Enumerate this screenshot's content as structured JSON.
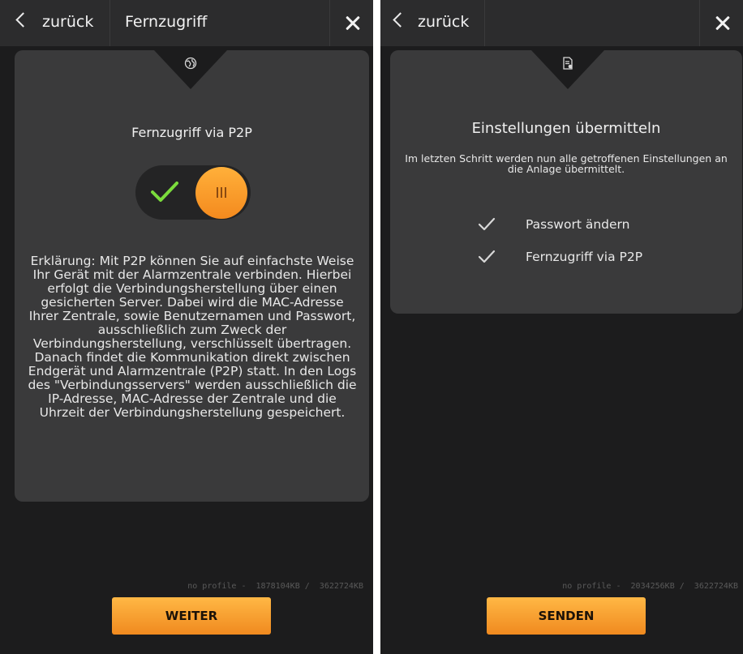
{
  "left_screen": {
    "header": {
      "back_label": "zurück",
      "title": "Fernzugriff"
    },
    "card": {
      "icon": "globe-icon",
      "heading": "Fernzugriff via P2P",
      "toggle": {
        "state": "on"
      },
      "explanation": "Erklärung: Mit P2P können Sie auf einfachste Weise Ihr Gerät mit der Alarmzentrale verbinden. Hierbei erfolgt die Verbindungsherstellung über einen gesicherten Server. Dabei wird die MAC-Adresse Ihrer Zentrale, sowie Benutzernamen und Passwort, ausschließlich zum Zweck der Verbindungsherstellung, verschlüsselt übertragen. Danach findet die Kommunikation direkt zwischen Endgerät und Alarmzentrale (P2P) statt. In den Logs des \"Verbindungsservers\" werden ausschließlich die IP-Adresse, MAC-Adresse der Zentrale und die Uhrzeit der Verbindungsherstellung gespeichert."
    },
    "footer_status": "no profile -  1878104KB /  3622724KB",
    "button_label": "WEITER"
  },
  "right_screen": {
    "header": {
      "back_label": "zurück"
    },
    "card": {
      "icon": "document-check-icon",
      "heading": "Einstellungen übermitteln",
      "subtext": "Im letzten Schritt werden nun alle getroffenen Einstellungen an die Anlage übermittelt.",
      "items": [
        "Passwort ändern",
        "Fernzugriff via P2P"
      ]
    },
    "footer_status": "no profile -  2034256KB /  3622724KB",
    "button_label": "SENDEN"
  },
  "colors": {
    "accent": "#f7a030",
    "check_green": "#7bdc3c",
    "background": "#1c1c1d",
    "card": "#3a3a3b"
  }
}
